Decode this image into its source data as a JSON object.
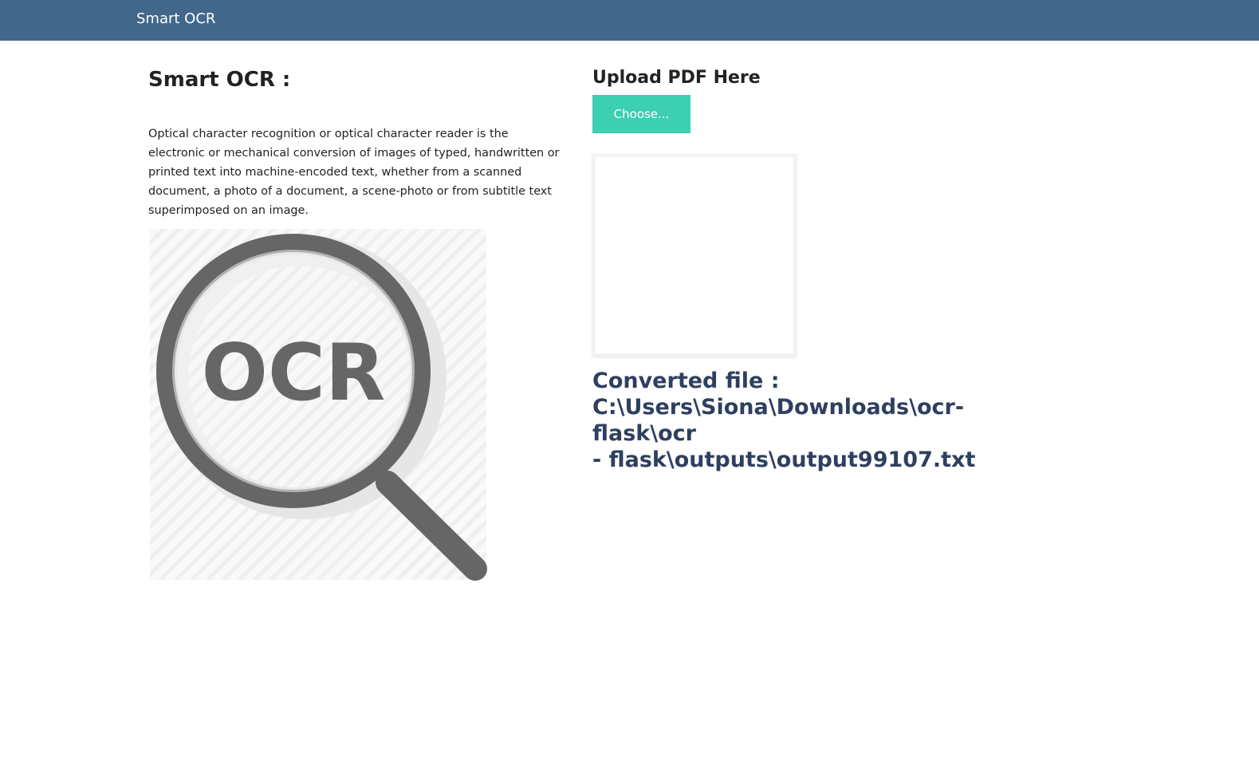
{
  "navbar": {
    "brand": "Smart OCR",
    "color": "#42678b"
  },
  "main": {
    "title": "Smart OCR :",
    "description": "Optical character recognition or optical character reader is the electronic or mechanical conversion of images of typed, handwritten or printed text into machine-encoded text, whether from a scanned document, a photo of a document, a scene-photo or from subtitle text superimposed on an image.",
    "figure": {
      "icon": "magnifier-icon",
      "text": "OCR"
    }
  },
  "upload": {
    "title": "Upload PDF Here",
    "button_label": "Choose...",
    "button_color": "#3ccfb2"
  },
  "result": {
    "label": "Converted file :",
    "path_line1": "C:\\Users\\Siona\\Downloads\\ocr-flask\\ocr",
    "path_line2": "- flask\\outputs\\output99107.txt",
    "color": "#2e4060"
  }
}
